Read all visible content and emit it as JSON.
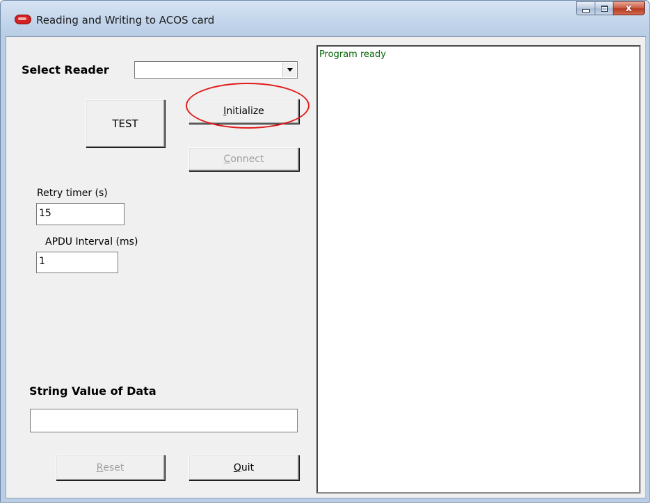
{
  "window": {
    "title": "Reading and Writing to ACOS card",
    "app_icon": "acs-logo-icon",
    "controls": {
      "minimize": "minimize-icon",
      "maximize": "maximize-icon",
      "close_glyph": "x"
    }
  },
  "form": {
    "select_reader_label": "Select Reader",
    "reader_selected": "",
    "test_button": "TEST",
    "initialize_button": {
      "accel": "I",
      "rest": "nitialize",
      "enabled": true
    },
    "connect_button": {
      "accel": "C",
      "rest": "onnect",
      "enabled": false
    },
    "retry_timer_label": "Retry timer (s)",
    "retry_timer_value": "15",
    "apdu_interval_label": "APDU Interval (ms)",
    "apdu_interval_value": "1",
    "string_value_label": "String Value of Data",
    "string_value": "",
    "reset_button": {
      "accel": "R",
      "rest": "eset",
      "enabled": false
    },
    "quit_button": {
      "accel": "Q",
      "rest": "uit",
      "enabled": true
    }
  },
  "log": {
    "lines": [
      "Program ready"
    ],
    "text_color": "#006400"
  },
  "annotation": {
    "highlight_color": "#e21b1b",
    "target": "initialize_button"
  }
}
